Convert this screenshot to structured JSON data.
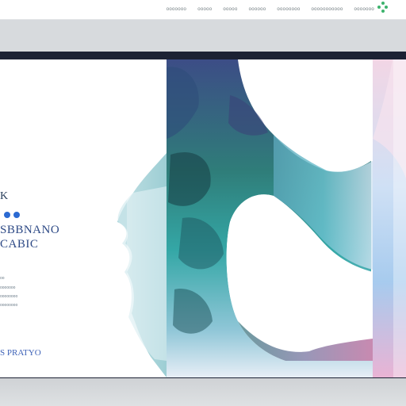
{
  "nav": {
    "items": [
      "ooooooo",
      "ooooo",
      "ooooo",
      "oooooo",
      "oooooooo",
      "ooooooooooo",
      "ooooooo"
    ]
  },
  "hero": {
    "eyebrow": "K",
    "heading_line1": "SBBNANO",
    "heading_line2": "CABIC",
    "meta_lines": [
      "oo",
      "ooooooo",
      "oooooooo",
      "oooooooo"
    ],
    "cta_label": "S PRATYO"
  },
  "colors": {
    "frame": "#1c2234",
    "accent_blue": "#2b6ad2",
    "heading": "#2e4a86",
    "logo_green": "#3db36d"
  }
}
